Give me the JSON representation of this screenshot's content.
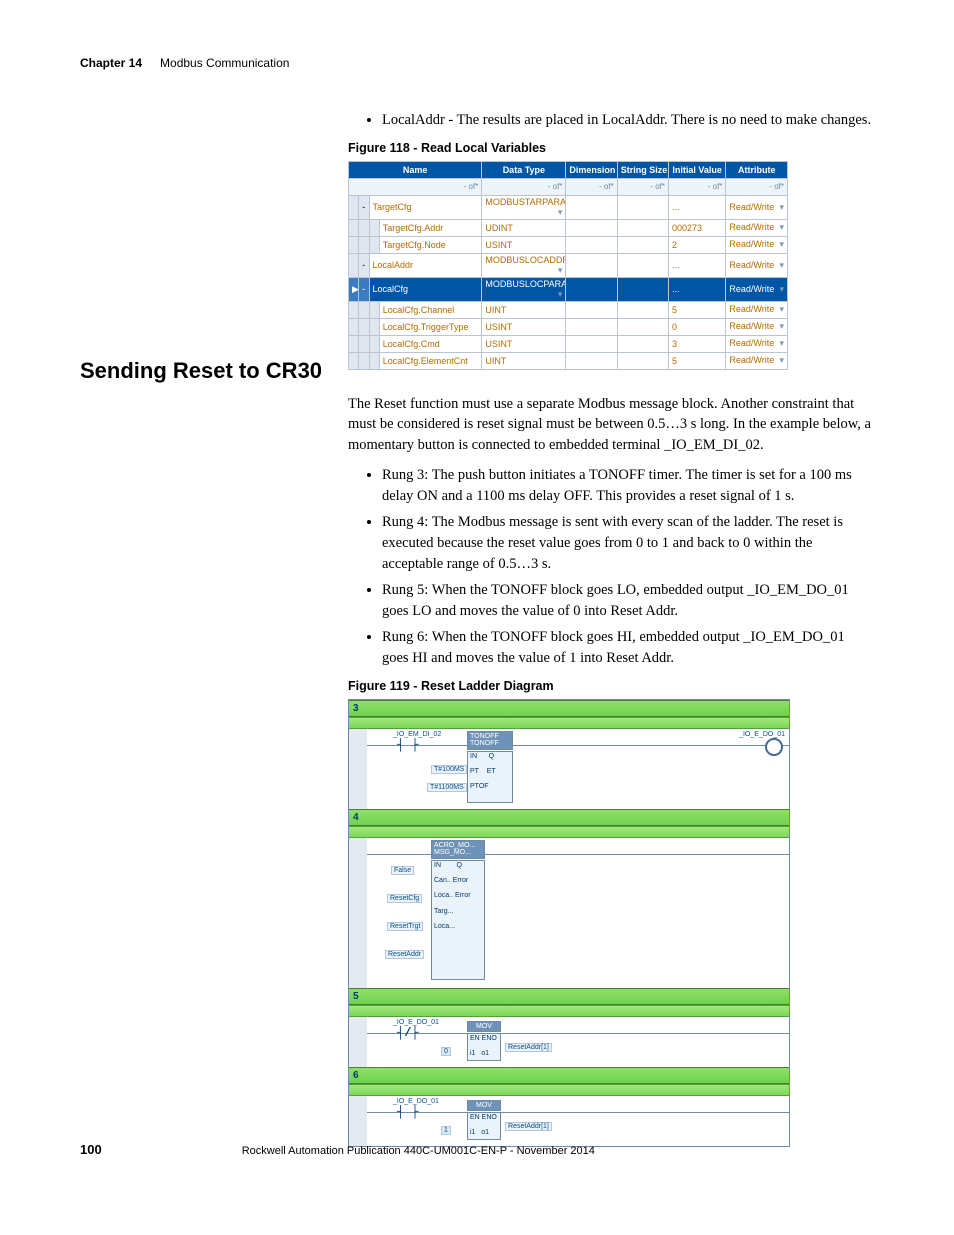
{
  "header": {
    "chapter_label": "Chapter 14",
    "chapter_title": "Modbus Communication"
  },
  "lead_bullets": [
    "LocalAddr - The results are placed in LocalAddr. There is no need to make changes."
  ],
  "fig118": {
    "caption": "Figure 118 - Read Local Variables",
    "columns": [
      "Name",
      "Data Type",
      "Dimension",
      "String Size",
      "Initial Value",
      "Attribute"
    ],
    "rows": [
      {
        "indent": 1,
        "name": "TargetCfg",
        "dtype": "MODBUSTARPARA",
        "ival": "...",
        "attr": "Read/Write"
      },
      {
        "indent": 2,
        "name": "TargetCfg.Addr",
        "dtype": "UDINT",
        "ival": "000273",
        "attr": "Read/Write"
      },
      {
        "indent": 2,
        "name": "TargetCfg.Node",
        "dtype": "USINT",
        "ival": "2",
        "attr": "Read/Write"
      },
      {
        "indent": 1,
        "name": "LocalAddr",
        "dtype": "MODBUSLOCADDR",
        "ival": "...",
        "attr": "Read/Write"
      },
      {
        "indent": 1,
        "name": "LocalCfg",
        "dtype": "MODBUSLOCPARA",
        "ival": "...",
        "attr": "Read/Write",
        "selected": true
      },
      {
        "indent": 2,
        "name": "LocalCfg.Channel",
        "dtype": "UINT",
        "ival": "5",
        "attr": "Read/Write"
      },
      {
        "indent": 2,
        "name": "LocalCfg.TriggerType",
        "dtype": "USINT",
        "ival": "0",
        "attr": "Read/Write"
      },
      {
        "indent": 2,
        "name": "LocalCfg.Cmd",
        "dtype": "USINT",
        "ival": "3",
        "attr": "Read/Write"
      },
      {
        "indent": 2,
        "name": "LocalCfg.ElementCnt",
        "dtype": "UINT",
        "ival": "5",
        "attr": "Read/Write"
      }
    ]
  },
  "section_heading": "Sending Reset to CR30",
  "section_intro": "The Reset function must use a separate Modbus message block. Another constraint that must be considered is reset signal must be between 0.5…3 s long. In the example below, a momentary button is connected to embedded terminal _IO_EM_DI_02.",
  "section_bullets": [
    "Rung 3: The push button initiates a TONOFF timer. The timer is set for a 100 ms delay ON and a 1100 ms delay OFF. This provides a reset signal of 1 s.",
    "Rung 4: The Modbus message is sent with every scan of the ladder. The reset is executed because the reset value goes from 0 to 1 and back to 0 within the acceptable range of 0.5…3 s.",
    "Rung 5: When the TONOFF block goes LO, embedded output _IO_EM_DO_01 goes LO and moves the value of 0 into Reset Addr.",
    "Rung 6: When the TONOFF block goes HI, embedded output _IO_EM_DO_01 goes HI and moves the value of 1 into Reset Addr."
  ],
  "fig119": {
    "caption": "Figure 119 - Reset Ladder Diagram",
    "rungs": {
      "3": {
        "contact": "_IO_EM_DI_02",
        "block": "TONOFF\nTONOFF",
        "pt": "T#100MS",
        "ptof": "T#1100MS",
        "pins": [
          "IN",
          "Q",
          "PT",
          "ET",
          "PTOF"
        ],
        "coil": "_IO_E_DO_01"
      },
      "4": {
        "block": "ACRO_MO...\nMSG_MO...",
        "tags": [
          "False",
          "ResetCfg",
          "ResetTrgt",
          "ResetAddr"
        ],
        "pins": [
          "IN",
          "Q",
          "Can...",
          "Error",
          "Loca..",
          "Error",
          "Targ...",
          "Loca..."
        ]
      },
      "5": {
        "contact": "_IO_E_DO_01",
        "nc": true,
        "block": "MOV",
        "pins": [
          "EN",
          "ENO",
          "i1",
          "o1"
        ],
        "val": "0",
        "dest": "ResetAddr[1]"
      },
      "6": {
        "contact": "_IO_E_DO_01",
        "nc": false,
        "block": "MOV",
        "pins": [
          "EN",
          "ENO",
          "i1",
          "o1"
        ],
        "val": "1",
        "dest": "ResetAddr[1]"
      }
    }
  },
  "footer": {
    "page": "100",
    "pub": "Rockwell Automation Publication 440C-UM001C-EN-P - November 2014"
  }
}
